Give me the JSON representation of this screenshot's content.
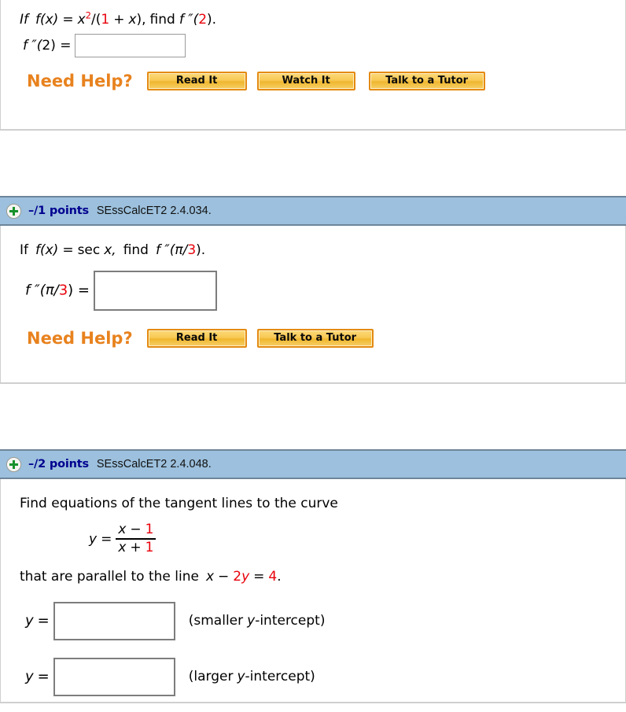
{
  "colors": {
    "header_bar": "#9cc0dd",
    "header_border": "#6e8599",
    "points_text": "#00008f",
    "need_help_orange": "#e8821e",
    "math_red": "#e8000a",
    "button_border": "#e48a12",
    "plus_green": "#17912b"
  },
  "questions": [
    {
      "id": "q-partial-top",
      "header": null,
      "prompt": {
        "lead": "If",
        "fn": "f(x)",
        "eq": "=",
        "expr_base": "x",
        "expr_sup": "2",
        "expr_rest_open": "/(",
        "expr_one": "1",
        "expr_plus": "+",
        "expr_var": "x",
        "expr_close": "),",
        "find": "find",
        "target_f": "f ″(",
        "target_arg": "2",
        "target_close": ")."
      },
      "answer": {
        "label_f": "f ″(",
        "label_arg": "2",
        "label_close": ") =",
        "value": "",
        "placeholder": ""
      },
      "help": {
        "label": "Need Help?",
        "buttons": [
          "Read It",
          "Watch It",
          "Talk to a Tutor"
        ]
      }
    },
    {
      "id": "q-2-4-034",
      "header": {
        "icon": "plus-circle-icon",
        "points": "–/1 points",
        "reference": "SEssCalcET2 2.4.034."
      },
      "prompt": {
        "lead": "If",
        "fn": "f(x)",
        "eq": "=",
        "sec": "sec",
        "var": "x,",
        "find": "find",
        "target_f": "f ″(",
        "target_pi": "π/",
        "target_num": "3",
        "target_close": ")."
      },
      "answer": {
        "label_f": "f ″(",
        "label_pi": "π/",
        "label_num": "3",
        "label_close": ") =",
        "value": "",
        "placeholder": ""
      },
      "help": {
        "label": "Need Help?",
        "buttons": [
          "Read It",
          "Talk to a Tutor"
        ]
      }
    },
    {
      "id": "q-2-4-048",
      "header": {
        "icon": "plus-circle-icon",
        "points": "–/2 points",
        "reference": "SEssCalcET2 2.4.048."
      },
      "prompt": {
        "line1": "Find equations of the tangent lines to the curve",
        "formula": {
          "lhs_y": "y",
          "eq": "=",
          "num_x": "x",
          "num_op": "−",
          "num_const": "1",
          "den_x": "x",
          "den_op": "+",
          "den_const": "1"
        },
        "line2_a": "that are parallel to the line",
        "line2_x": "x",
        "line2_minus": "−",
        "line2_two": "2",
        "line2_y": "y",
        "line2_eq": "=",
        "line2_four": "4",
        "line2_period": "."
      },
      "answers": [
        {
          "label_y": "y",
          "label_eq": "=",
          "value": "",
          "placeholder": "",
          "note_open": "(smaller",
          "note_y": "y",
          "note_rest": "-intercept)"
        },
        {
          "label_y": "y",
          "label_eq": "=",
          "value": "",
          "placeholder": "",
          "note_open": "(larger",
          "note_y": "y",
          "note_rest": "-intercept)"
        }
      ]
    }
  ]
}
